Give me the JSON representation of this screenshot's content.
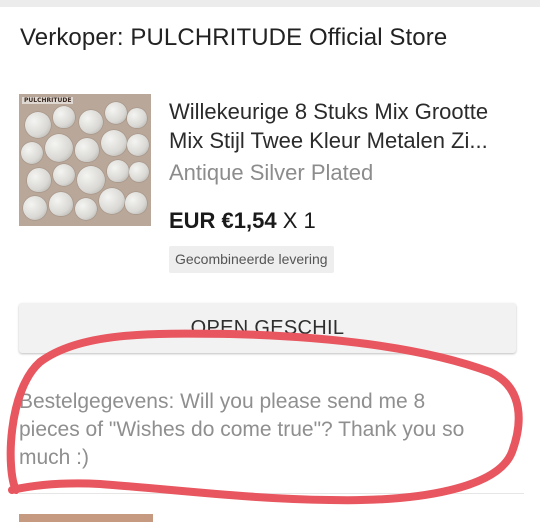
{
  "seller": {
    "label": "Verkoper: PULCHRITUDE Official Store"
  },
  "product": {
    "image_brand_text": "PULCHRITUDE",
    "title_line_1": "Willekeurige 8 Stuks Mix Grootte",
    "title_line_2": "Mix Stijl Twee Kleur Metalen Zi...",
    "variant": "Antique Silver Plated",
    "price": "EUR €1,54",
    "quantity": "X 1",
    "shipping_badge": "Gecombineerde levering"
  },
  "actions": {
    "open_dispute_label": "OPEN GESCHIL"
  },
  "order_details": {
    "text": "Bestelgegevens: Will you please send me 8 pieces of \"Wishes do come true\"? Thank you so much :)"
  },
  "colors": {
    "annotation_stroke": "#e8565f",
    "button_background": "#f2f2f2",
    "secondary_text": "#8c8c8c"
  }
}
